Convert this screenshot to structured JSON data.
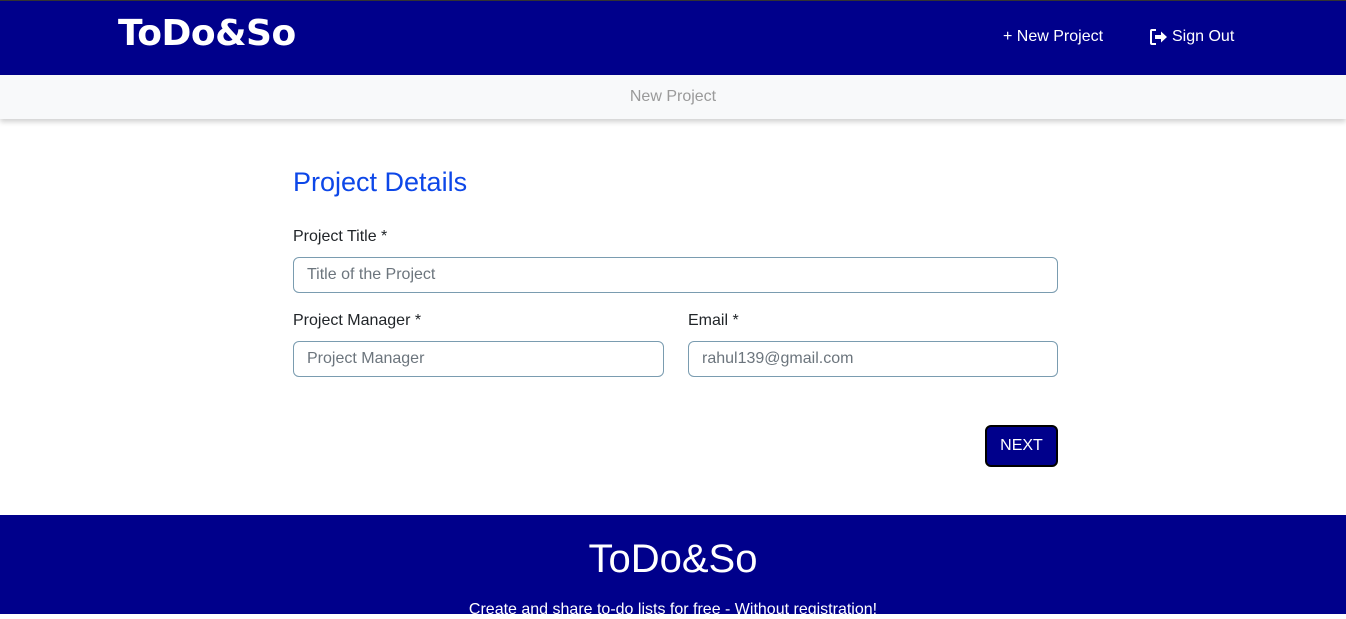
{
  "navbar": {
    "brand": "ToDo&So",
    "new_project_label": "+ New Project",
    "sign_out_label": "Sign Out",
    "sign_out_icon": "sign-out-icon",
    "background": "#00008b"
  },
  "subbar": {
    "title": "New Project"
  },
  "form": {
    "section_title": "Project Details",
    "project_title": {
      "label": "Project Title *",
      "placeholder": "Title of the Project",
      "value": ""
    },
    "project_manager": {
      "label": "Project Manager *",
      "placeholder": "Project Manager",
      "value": ""
    },
    "email": {
      "label": "Email *",
      "placeholder": "rahul139@gmail.com",
      "value": ""
    },
    "next_label": "NEXT"
  },
  "footer": {
    "brand": "ToDo&So",
    "tagline": "Create and share to-do lists for free - Without registration!"
  },
  "colors": {
    "primary": "#00008b",
    "heading": "#0d47e8"
  }
}
